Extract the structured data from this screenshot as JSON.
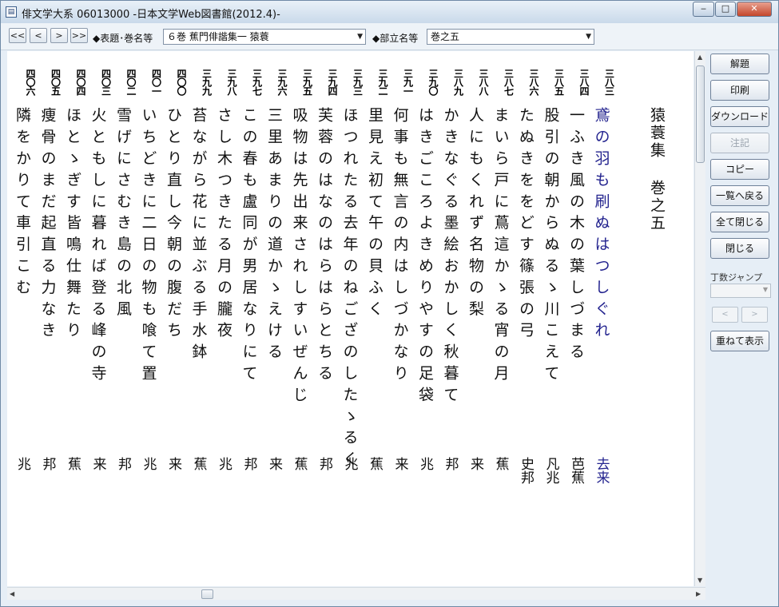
{
  "window": {
    "title": "俳文学大系 06013000 -日本文学Web図書館(2012.4)-",
    "icon": "app-book-icon",
    "minimize": "‒",
    "maximize": "□",
    "close": "✕"
  },
  "toolbar": {
    "nav": [
      "<<",
      "<",
      ">",
      ">>"
    ],
    "title_label": "◆表題･巻名等",
    "title_value": "６巻 蕉門俳諧集一 猿蓑",
    "section_label": "◆部立名等",
    "section_value": "巻之五"
  },
  "document": {
    "collection_title": "猿蓑集 巻之五",
    "verses": [
      {
        "no": "四〇六",
        "text": "隣をかりて車引こむ",
        "poet": "兆"
      },
      {
        "no": "四〇五",
        "text": "痩骨のまだ起直る力なき",
        "poet": "邦"
      },
      {
        "no": "四〇四",
        "text": "ほとゝぎす皆鳴仕舞たり",
        "poet": "蕉"
      },
      {
        "no": "四〇三",
        "text": "火ともしに暮れば登る峰の寺",
        "poet": "来"
      },
      {
        "no": "四〇二",
        "text": "雪げにさむき島の北風",
        "poet": "邦"
      },
      {
        "no": "四〇一",
        "text": "いちどきに二日の物も喰て置",
        "poet": "兆"
      },
      {
        "no": "四〇〇",
        "text": "ひとり直し今朝の腹だち",
        "poet": "来"
      },
      {
        "no": "三九九",
        "text": "苔ながら花に並ぶる手水鉢",
        "poet": "蕉"
      },
      {
        "no": "三九八",
        "text": "さし木つきたる月の朧夜",
        "poet": "兆"
      },
      {
        "no": "三九七",
        "text": "この春も盧同が男居なりにて",
        "poet": "邦"
      },
      {
        "no": "三九六",
        "text": "三里あまりの道かゝえける",
        "poet": "来"
      },
      {
        "no": "三九五",
        "text": "吸物は先出来されしすいぜんじ",
        "poet": "蕉"
      },
      {
        "no": "三九四",
        "text": "芙蓉のはなのはらはらとちる",
        "poet": "邦"
      },
      {
        "no": "三九三",
        "text": "ほつれたる去年のねござのしたゝるく",
        "poet": "兆"
      },
      {
        "no": "三九二",
        "text": "里見え初て午の貝ふく",
        "poet": "蕉"
      },
      {
        "no": "三九一",
        "text": "何事も無言の内はしづかなり",
        "poet": "来"
      },
      {
        "no": "三九〇",
        "text": "はきごころよきめりやすの足袋",
        "poet": "兆"
      },
      {
        "no": "三八九",
        "text": "かきなぐる墨絵おかしく秋暮て",
        "poet": "邦"
      },
      {
        "no": "三八八",
        "text": "人にもくれず名物の梨",
        "poet": "来"
      },
      {
        "no": "三八七",
        "text": "まいら戸に蔦這かゝる宵の月",
        "poet": "蕉"
      },
      {
        "no": "三八六",
        "text": "たぬきををどす篠張の弓",
        "poet": "史邦"
      },
      {
        "no": "三八五",
        "text": "股引の朝からぬるゝ川こえて",
        "poet": "凡兆"
      },
      {
        "no": "三八四",
        "text": "一ふき風の木の葉しづまる",
        "poet": "芭蕉"
      },
      {
        "no": "三八三",
        "text": "鳶の羽も刷ぬはつしぐれ",
        "poet": "去来"
      }
    ]
  },
  "sidebar": {
    "buttons": [
      "解題",
      "印刷",
      "ダウンロード",
      "注記",
      "コピー",
      "一覧へ戻る",
      "全て閉じる",
      "閉じる"
    ],
    "jump_label": "丁数ジャンプ",
    "prev": "<",
    "next": ">",
    "overlay": "重ねて表示"
  }
}
